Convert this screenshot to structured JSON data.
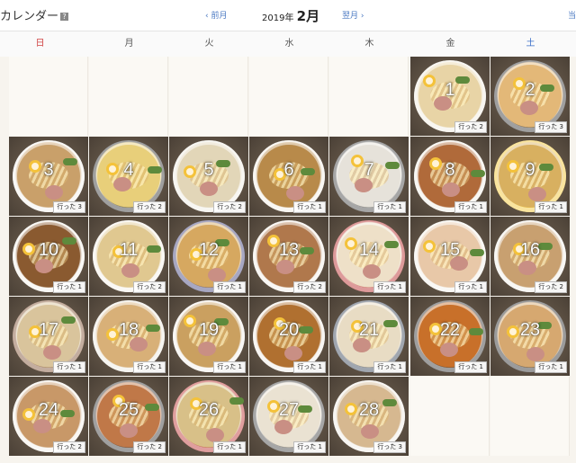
{
  "header": {
    "title": "カレンダー",
    "help_icon": "question-icon",
    "prev_label": "‹ 前月",
    "next_label": "翌月 ›",
    "year_label": "2019年",
    "month_label": "2月",
    "top_right_label": "当"
  },
  "weekdays": [
    "日",
    "月",
    "火",
    "水",
    "木",
    "金",
    "土"
  ],
  "colors": {
    "sunday": "#d04040",
    "saturday": "#3a6ec8",
    "link": "#4a78c2"
  },
  "days": [
    {
      "num": "1",
      "badge": "行った 2",
      "soup": "#e8d4a6",
      "rim": "#f0ece0"
    },
    {
      "num": "2",
      "badge": "行った 3",
      "soup": "#e3b878",
      "rim": "#2a2a2a"
    },
    {
      "num": "3",
      "badge": "行った 3",
      "soup": "#c9a06a",
      "rim": "#f2f0ea"
    },
    {
      "num": "4",
      "badge": "行った 2",
      "soup": "#e8cf7a",
      "rim": "#2b2b2b"
    },
    {
      "num": "5",
      "badge": "行った 2",
      "soup": "#e2d6b8",
      "rim": "#eeeae2"
    },
    {
      "num": "6",
      "badge": "行った 1",
      "soup": "#b88a4a",
      "rim": "#f1ede4"
    },
    {
      "num": "7",
      "badge": "行った 1",
      "soup": "#e6e2da",
      "rim": "#3a3a3a"
    },
    {
      "num": "8",
      "badge": "行った 1",
      "soup": "#b06a3a",
      "rim": "#f0ede5"
    },
    {
      "num": "9",
      "badge": "行った 1",
      "soup": "#d8b060",
      "rim": "#f2c428"
    },
    {
      "num": "10",
      "badge": "行った 1",
      "soup": "#8a5a30",
      "rim": "#f1efe8"
    },
    {
      "num": "11",
      "badge": "行った 2",
      "soup": "#e0c890",
      "rim": "#f3efe6"
    },
    {
      "num": "12",
      "badge": "行った 1",
      "soup": "#d6a860",
      "rim": "#3c3c78"
    },
    {
      "num": "13",
      "badge": "行った 2",
      "soup": "#b0784c",
      "rim": "#f2eee6"
    },
    {
      "num": "14",
      "badge": "行った 1",
      "soup": "#eee0c8",
      "rim": "#b42020"
    },
    {
      "num": "15",
      "badge": "行った 1",
      "soup": "#e8c8a8",
      "rim": "#f2efe8"
    },
    {
      "num": "16",
      "badge": "行った 2",
      "soup": "#c8a070",
      "rim": "#f0ede6"
    },
    {
      "num": "17",
      "badge": "行った 1",
      "soup": "#d9c49c",
      "rim": "#7a4a2a"
    },
    {
      "num": "18",
      "badge": "行った 1",
      "soup": "#d8b078",
      "rim": "#ece8e0"
    },
    {
      "num": "19",
      "badge": "行った 1",
      "soup": "#caa060",
      "rim": "#f1eee8"
    },
    {
      "num": "20",
      "badge": "行った 1",
      "soup": "#b07030",
      "rim": "#f0ece4"
    },
    {
      "num": "21",
      "badge": "行った 1",
      "soup": "#e8dcc4",
      "rim": "#2e3a4e"
    },
    {
      "num": "22",
      "badge": "行った 1",
      "soup": "#c8702a",
      "rim": "#2a2a2a"
    },
    {
      "num": "23",
      "badge": "行った 1",
      "soup": "#d6a870",
      "rim": "#222222"
    },
    {
      "num": "24",
      "badge": "行った 2",
      "soup": "#c89868",
      "rim": "#f1eee6"
    },
    {
      "num": "25",
      "badge": "行った 2",
      "soup": "#c07848",
      "rim": "#2e2e2e"
    },
    {
      "num": "26",
      "badge": "行った 1",
      "soup": "#d8c088",
      "rim": "#b82828"
    },
    {
      "num": "27",
      "badge": "行った 1",
      "soup": "#eae2d2",
      "rim": "#3a3a3a"
    },
    {
      "num": "28",
      "badge": "行った 3",
      "soup": "#d6b890",
      "rim": "#f0ece4"
    }
  ]
}
